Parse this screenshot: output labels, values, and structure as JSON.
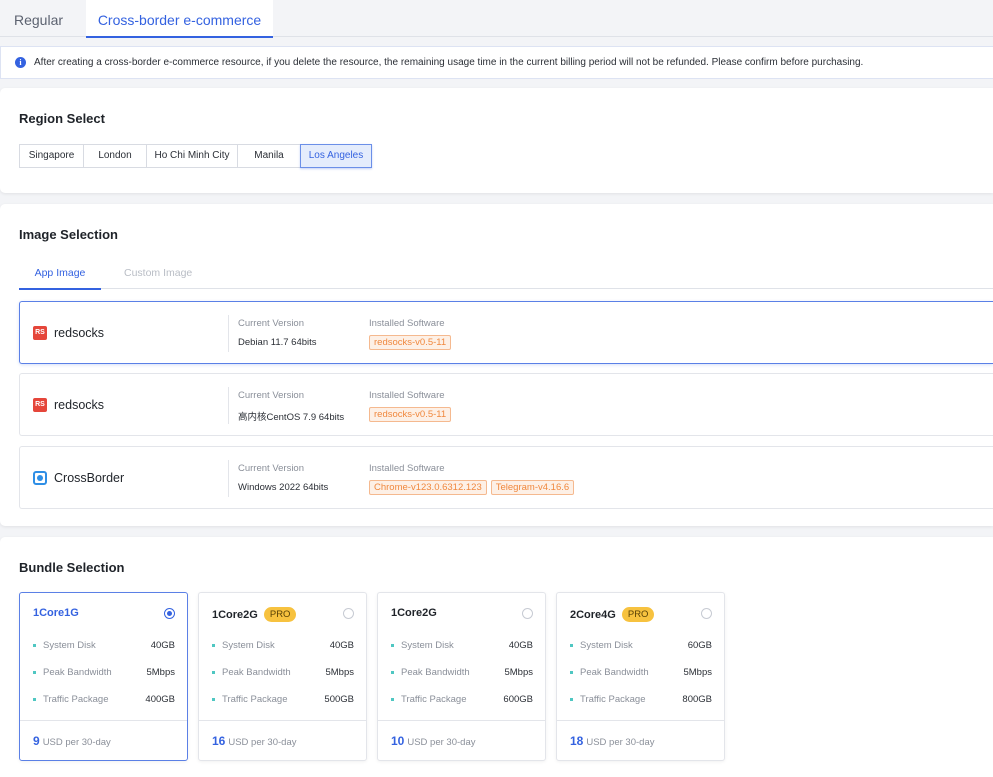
{
  "top_tabs": [
    "Regular",
    "Cross-border e-commerce"
  ],
  "notice": {
    "icon": "info-icon",
    "text": "After creating a cross-border e-commerce resource, if you delete the resource, the remaining usage time in the current billing period will not be refunded. Please confirm before purchasing."
  },
  "region": {
    "title": "Region Select",
    "options": [
      "Singapore",
      "London",
      "Ho Chi Minh City",
      "Manila",
      "Los Angeles"
    ],
    "selected": "Los Angeles"
  },
  "image": {
    "title": "Image Selection",
    "tabs": [
      "App Image",
      "Custom Image"
    ],
    "active_tab": "App Image",
    "version_label": "Current Version",
    "software_label": "Installed Software",
    "cards": [
      {
        "logo": "RS",
        "name": "redsocks",
        "version": "Debian 11.7 64bits",
        "software": [
          "redsocks-v0.5-11"
        ]
      },
      {
        "logo": "RS",
        "name": "redsocks",
        "version": "高内核CentOS 7.9 64bits",
        "software": [
          "redsocks-v0.5-11"
        ]
      },
      {
        "logo": "",
        "name": "CrossBorder",
        "version": "Windows 2022 64bits",
        "software": [
          "Chrome-v123.0.6312.123",
          "Telegram-v4.16.6"
        ]
      }
    ]
  },
  "bundle": {
    "title": "Bundle Selection",
    "spec_labels": [
      "System Disk",
      "Peak Bandwidth",
      "Traffic Package"
    ],
    "price_suffix": "USD per 30-day",
    "pro_label": "PRO",
    "items": [
      {
        "name": "1Core1G",
        "pro": false,
        "disk": "40GB",
        "bandwidth": "5Mbps",
        "traffic": "400GB",
        "price": "9",
        "selected": true
      },
      {
        "name": "1Core2G",
        "pro": true,
        "disk": "40GB",
        "bandwidth": "5Mbps",
        "traffic": "500GB",
        "price": "16",
        "selected": false
      },
      {
        "name": "1Core2G",
        "pro": false,
        "disk": "40GB",
        "bandwidth": "5Mbps",
        "traffic": "600GB",
        "price": "10",
        "selected": false
      },
      {
        "name": "2Core4G",
        "pro": true,
        "disk": "60GB",
        "bandwidth": "5Mbps",
        "traffic": "800GB",
        "price": "18",
        "selected": false
      }
    ]
  },
  "colors": {
    "accent": "#3462e0",
    "tag": "#f0883e",
    "pro": "#f7c23f",
    "dot": "#4fc7c2"
  }
}
